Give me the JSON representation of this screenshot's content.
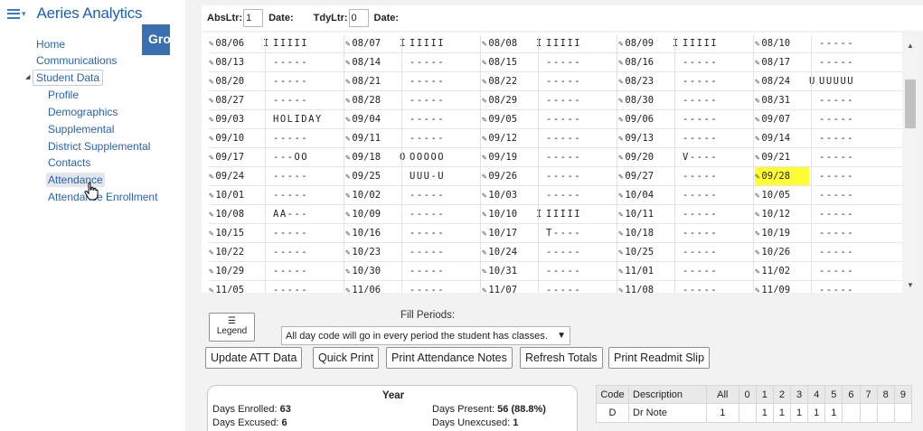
{
  "app": {
    "title": "Aeries Analytics",
    "tab_stub": "Gro"
  },
  "nav": {
    "items": [
      {
        "label": "Home"
      },
      {
        "label": "Communications"
      },
      {
        "label": "Student Data"
      },
      {
        "label": "Profile"
      },
      {
        "label": "Demographics"
      },
      {
        "label": "Supplemental"
      },
      {
        "label": "District Supplemental"
      },
      {
        "label": "Contacts"
      },
      {
        "label": "Attendance"
      },
      {
        "label": "Attendance Enrollment"
      }
    ]
  },
  "toolbar": {
    "abs_label": "AbsLtr:",
    "abs_value": "1",
    "abs_date_label": "Date:",
    "tdy_label": "TdyLtr:",
    "tdy_value": "0",
    "tdy_date_label": "Date:"
  },
  "calendar": {
    "rows": [
      [
        [
          "08/06",
          "I",
          "IIIII"
        ],
        [
          "08/07",
          "I",
          "IIIII"
        ],
        [
          "08/08",
          "I",
          "IIIII"
        ],
        [
          "08/09",
          "I",
          "IIIII"
        ],
        [
          "08/10",
          "",
          "-----"
        ]
      ],
      [
        [
          "08/13",
          "",
          "-----"
        ],
        [
          "08/14",
          "",
          "-----"
        ],
        [
          "08/15",
          "",
          "-----"
        ],
        [
          "08/16",
          "",
          "-----"
        ],
        [
          "08/17",
          "",
          "-----"
        ]
      ],
      [
        [
          "08/20",
          "",
          "-----"
        ],
        [
          "08/21",
          "",
          "-----"
        ],
        [
          "08/22",
          "",
          "-----"
        ],
        [
          "08/23",
          "",
          "-----"
        ],
        [
          "08/24",
          "U",
          "UUUUU"
        ]
      ],
      [
        [
          "08/27",
          "",
          "-----"
        ],
        [
          "08/28",
          "",
          "-----"
        ],
        [
          "08/29",
          "",
          "-----"
        ],
        [
          "08/30",
          "",
          "-----"
        ],
        [
          "08/31",
          "",
          "-----"
        ]
      ],
      [
        [
          "09/03",
          "",
          "HOLIDAY"
        ],
        [
          "09/04",
          "",
          "-----"
        ],
        [
          "09/05",
          "",
          "-----"
        ],
        [
          "09/06",
          "",
          "-----"
        ],
        [
          "09/07",
          "",
          "-----"
        ]
      ],
      [
        [
          "09/10",
          "",
          "-----"
        ],
        [
          "09/11",
          "",
          "-----"
        ],
        [
          "09/12",
          "",
          "-----"
        ],
        [
          "09/13",
          "",
          "-----"
        ],
        [
          "09/14",
          "",
          "-----"
        ]
      ],
      [
        [
          "09/17",
          "",
          "---OO"
        ],
        [
          "09/18",
          "O",
          "OOOOO"
        ],
        [
          "09/19",
          "",
          "-----"
        ],
        [
          "09/20",
          "",
          "V----"
        ],
        [
          "09/21",
          "",
          "-----"
        ]
      ],
      [
        [
          "09/24",
          "",
          "-----"
        ],
        [
          "09/25",
          "",
          "UUU-U"
        ],
        [
          "09/26",
          "",
          "-----"
        ],
        [
          "09/27",
          "",
          "-----"
        ],
        [
          "09/28",
          "",
          "-----"
        ]
      ],
      [
        [
          "10/01",
          "",
          "-----"
        ],
        [
          "10/02",
          "",
          "-----"
        ],
        [
          "10/03",
          "",
          "-----"
        ],
        [
          "10/04",
          "",
          "-----"
        ],
        [
          "10/05",
          "",
          "-----"
        ]
      ],
      [
        [
          "10/08",
          "",
          "AA---"
        ],
        [
          "10/09",
          "",
          "-----"
        ],
        [
          "10/10",
          "I",
          "IIIII"
        ],
        [
          "10/11",
          "",
          "-----"
        ],
        [
          "10/12",
          "",
          "-----"
        ]
      ],
      [
        [
          "10/15",
          "",
          "-----"
        ],
        [
          "10/16",
          "",
          "-----"
        ],
        [
          "10/17",
          "",
          "T----"
        ],
        [
          "10/18",
          "",
          "-----"
        ],
        [
          "10/19",
          "",
          "-----"
        ]
      ],
      [
        [
          "10/22",
          "",
          "-----"
        ],
        [
          "10/23",
          "",
          "-----"
        ],
        [
          "10/24",
          "",
          "-----"
        ],
        [
          "10/25",
          "",
          "-----"
        ],
        [
          "10/26",
          "",
          "-----"
        ]
      ],
      [
        [
          "10/29",
          "",
          "-----"
        ],
        [
          "10/30",
          "",
          "-----"
        ],
        [
          "10/31",
          "",
          "-----"
        ],
        [
          "11/01",
          "",
          "-----"
        ],
        [
          "11/02",
          "",
          "-----"
        ]
      ],
      [
        [
          "11/05",
          "",
          "-----"
        ],
        [
          "11/06",
          "",
          "-----"
        ],
        [
          "11/07",
          "",
          "-----"
        ],
        [
          "11/08",
          "",
          "-----"
        ],
        [
          "11/09",
          "",
          "-----"
        ]
      ]
    ],
    "highlight_date": "09/28",
    "highlight_color": "#ffff33"
  },
  "legend": {
    "label": "Legend",
    "icon": "list-icon"
  },
  "fill_periods": {
    "label": "Fill Periods:",
    "selected": "All day code will go in every period the student has classes."
  },
  "buttons": {
    "update": "Update ATT Data",
    "quick_print": "Quick Print",
    "print_notes": "Print Attendance Notes",
    "refresh": "Refresh Totals",
    "readmit": "Print Readmit Slip"
  },
  "year_summary": {
    "title": "Year",
    "enrolled_label": "Days Enrolled:",
    "enrolled_value": "63",
    "present_label": "Days Present:",
    "present_value": "56 (88.8%)",
    "excused_label": "Days Excused:",
    "excused_value": "6",
    "unexcused_label": "Days Unexcused:",
    "unexcused_value": "1"
  },
  "code_table": {
    "headers": [
      "Code",
      "Description",
      "All",
      "0",
      "1",
      "2",
      "3",
      "4",
      "5",
      "6",
      "7",
      "8",
      "9"
    ],
    "rows": [
      [
        "D",
        "Dr Note",
        "1",
        "",
        "1",
        "1",
        "1",
        "1",
        "1",
        "",
        "",
        "",
        ""
      ]
    ]
  },
  "colors": {
    "accent": "#2a63ad",
    "brand_tab": "#3a6fb0",
    "highlight": "#ffff33"
  }
}
